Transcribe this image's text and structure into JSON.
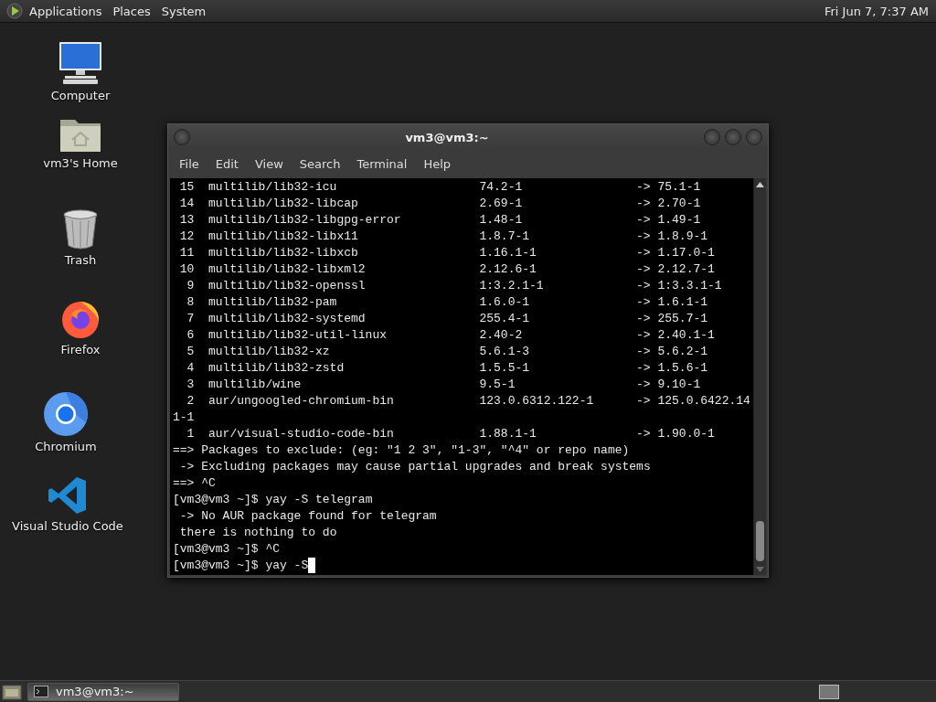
{
  "top_panel": {
    "menus": [
      "Applications",
      "Places",
      "System"
    ],
    "clock": "Fri Jun 7, 7:37 AM"
  },
  "desktop_icons": [
    {
      "label": "Computer",
      "kind": "computer"
    },
    {
      "label": "vm3's Home",
      "kind": "home"
    },
    {
      "label": "Trash",
      "kind": "trash"
    },
    {
      "label": "Firefox",
      "kind": "firefox"
    },
    {
      "label": "Chromium",
      "kind": "chromium"
    },
    {
      "label": "Visual Studio Code",
      "kind": "vscode"
    }
  ],
  "terminal_window": {
    "title": "vm3@vm3:~",
    "menus": [
      "File",
      "Edit",
      "View",
      "Search",
      "Terminal",
      "Help"
    ],
    "lines": [
      {
        "kind": "package",
        "number": "15",
        "name": "multilib/lib32-icu",
        "old": "74.2-1",
        "new": "-> 75.1-1"
      },
      {
        "kind": "package",
        "number": "14",
        "name": "multilib/lib32-libcap",
        "old": "2.69-1",
        "new": "-> 2.70-1"
      },
      {
        "kind": "package",
        "number": "13",
        "name": "multilib/lib32-libgpg-error",
        "old": "1.48-1",
        "new": "-> 1.49-1"
      },
      {
        "kind": "package",
        "number": "12",
        "name": "multilib/lib32-libx11",
        "old": "1.8.7-1",
        "new": "-> 1.8.9-1"
      },
      {
        "kind": "package",
        "number": "11",
        "name": "multilib/lib32-libxcb",
        "old": "1.16.1-1",
        "new": "-> 1.17.0-1"
      },
      {
        "kind": "package",
        "number": "10",
        "name": "multilib/lib32-libxml2",
        "old": "2.12.6-1",
        "new": "-> 2.12.7-1"
      },
      {
        "kind": "package",
        "number": "9",
        "name": "multilib/lib32-openssl",
        "old": "1:3.2.1-1",
        "new": "-> 1:3.3.1-1"
      },
      {
        "kind": "package",
        "number": "8",
        "name": "multilib/lib32-pam",
        "old": "1.6.0-1",
        "new": "-> 1.6.1-1"
      },
      {
        "kind": "package",
        "number": "7",
        "name": "multilib/lib32-systemd",
        "old": "255.4-1",
        "new": "-> 255.7-1"
      },
      {
        "kind": "package",
        "number": "6",
        "name": "multilib/lib32-util-linux",
        "old": "2.40-2",
        "new": "-> 2.40.1-1"
      },
      {
        "kind": "package",
        "number": "5",
        "name": "multilib/lib32-xz",
        "old": "5.6.1-3",
        "new": "-> 5.6.2-1"
      },
      {
        "kind": "package",
        "number": "4",
        "name": "multilib/lib32-zstd",
        "old": "1.5.5-1",
        "new": "-> 1.5.6-1"
      },
      {
        "kind": "package",
        "number": "3",
        "name": "multilib/wine",
        "old": "9.5-1",
        "new": "-> 9.10-1"
      },
      {
        "kind": "package",
        "number": "2",
        "name": "aur/ungoogled-chromium-bin",
        "old": "123.0.6312.122-1",
        "new": "-> 125.0.6422.14"
      },
      {
        "kind": "text",
        "text": "1-1"
      },
      {
        "kind": "package",
        "number": "1",
        "name": "aur/visual-studio-code-bin",
        "old": "1.88.1-1",
        "new": "-> 1.90.0-1"
      },
      {
        "kind": "text",
        "text": "==> Packages to exclude: (eg: \"1 2 3\", \"1-3\", \"^4\" or repo name)"
      },
      {
        "kind": "text",
        "text": " -> Excluding packages may cause partial upgrades and break systems"
      },
      {
        "kind": "text",
        "text": "==> ^C"
      },
      {
        "kind": "text",
        "text": "[vm3@vm3 ~]$ yay -S telegram"
      },
      {
        "kind": "text",
        "text": " -> No AUR package found for telegram"
      },
      {
        "kind": "text",
        "text": " there is nothing to do"
      },
      {
        "kind": "text",
        "text": "[vm3@vm3 ~]$ ^C"
      },
      {
        "kind": "prompt",
        "text": "[vm3@vm3 ~]$ yay -S"
      }
    ]
  },
  "taskbar": {
    "tasks": [
      {
        "label": "vm3@vm3:~",
        "selected": true
      }
    ]
  }
}
